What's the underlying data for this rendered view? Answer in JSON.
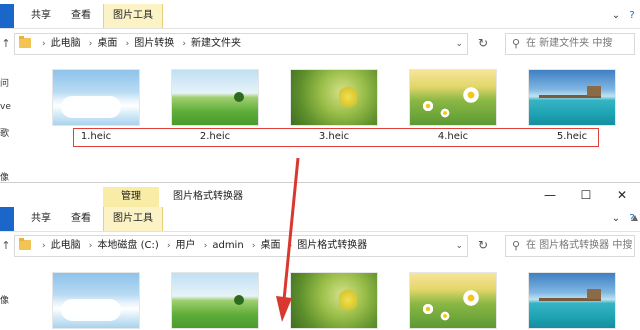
{
  "window1": {
    "tabs": {
      "home": "共享",
      "view": "查看",
      "tools": "图片工具"
    },
    "expand_glyph": "⌄",
    "help_glyph": "?",
    "address": {
      "crumbs": [
        "此电脑",
        "桌面",
        "图片转换",
        "新建文件夹"
      ]
    },
    "search": {
      "placeholder": "在 新建文件夹 中搜"
    },
    "nav_edge": [
      "问",
      "ve",
      "歌",
      "像"
    ],
    "files": [
      {
        "name": "1.heic",
        "thumb": "sky-clouds"
      },
      {
        "name": "2.heic",
        "thumb": "green-field"
      },
      {
        "name": "3.heic",
        "thumb": "yellow-flowers"
      },
      {
        "name": "4.heic",
        "thumb": "daisies"
      },
      {
        "name": "5.heic",
        "thumb": "beach-pier"
      }
    ]
  },
  "window2": {
    "context_tab": "管理",
    "title": "图片格式转换器",
    "tabs": {
      "home": "共享",
      "view": "查看",
      "tools": "图片工具"
    },
    "controls": {
      "minimize": "—",
      "maximize": "☐",
      "close": "✕"
    },
    "help_glyph": "?",
    "address": {
      "crumbs": [
        "此电脑",
        "本地磁盘 (C:)",
        "用户",
        "admin",
        "桌面",
        "图片格式转换器"
      ]
    },
    "search": {
      "placeholder": "在 图片格式转换器 中搜"
    },
    "nav_edge": [
      "像"
    ],
    "files": [
      {
        "thumb": "sky-clouds"
      },
      {
        "thumb": "green-field"
      },
      {
        "thumb": "yellow-flowers"
      },
      {
        "thumb": "daisies"
      },
      {
        "thumb": "beach-pier"
      }
    ]
  },
  "colors": {
    "file_tab": "#1a66c9",
    "context_tab": "#f9eca7",
    "highlight_box": "#e0403a",
    "arrow": "#d9382f"
  }
}
